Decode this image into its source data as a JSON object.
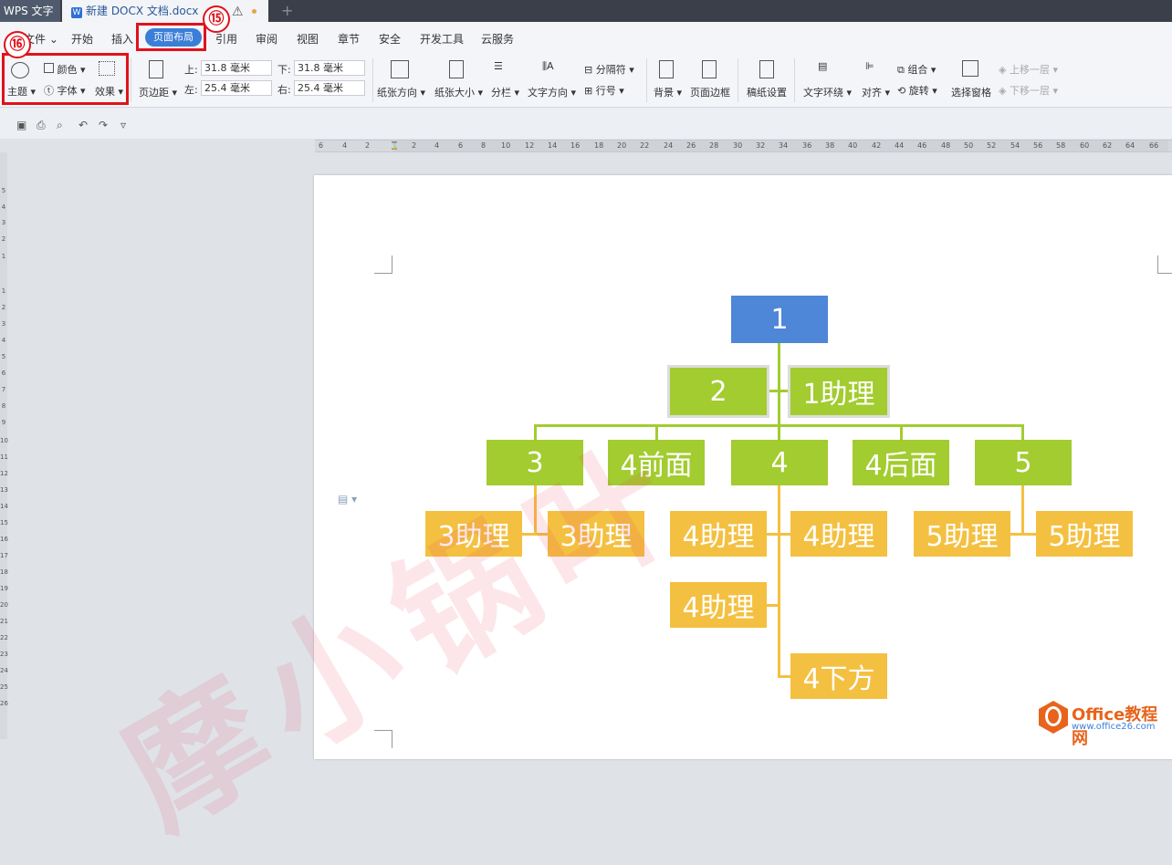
{
  "app": {
    "tab_app": "WPS 文字",
    "tab_doc": "新建 DOCX 文档.docx",
    "warning": "⚠",
    "add_tab": "+"
  },
  "menu": {
    "file": "文件",
    "items": [
      "开始",
      "插入",
      "页面布局",
      "引用",
      "审阅",
      "视图",
      "章节",
      "安全",
      "开发工具",
      "云服务"
    ],
    "active": "页面布局"
  },
  "ribbon": {
    "theme": "主题",
    "color": "颜色",
    "font": "字体",
    "effect": "效果",
    "margins": "页边距",
    "top_label": "上:",
    "top_value": "31.8 毫米",
    "bottom_label": "下:",
    "bottom_value": "31.8 毫米",
    "left_label": "左:",
    "left_value": "25.4 毫米",
    "right_label": "右:",
    "right_value": "25.4 毫米",
    "orientation": "纸张方向",
    "size": "纸张大小",
    "columns": "分栏",
    "text_dir": "文字方向",
    "separator": "分隔符",
    "line_num": "行号",
    "background": "背景",
    "border": "页面边框",
    "paper": "稿纸设置",
    "wrap": "文字环绕",
    "align": "对齐",
    "group": "组合",
    "rotate": "旋转",
    "select_pane": "选择窗格",
    "up": "上移一层",
    "down": "下移一层"
  },
  "ruler": {
    "ticks": [
      "6",
      "4",
      "2",
      "2",
      "4",
      "6",
      "8",
      "10",
      "12",
      "14",
      "16",
      "18",
      "20",
      "22",
      "24",
      "26",
      "28",
      "30",
      "32",
      "34",
      "36",
      "38",
      "40",
      "42",
      "44",
      "46",
      "48",
      "50",
      "52",
      "54",
      "56",
      "58",
      "60",
      "62",
      "64",
      "66"
    ]
  },
  "vruler": {
    "ticks": [
      "5",
      "4",
      "3",
      "2",
      "1",
      "1",
      "2",
      "3",
      "4",
      "5",
      "6",
      "7",
      "8",
      "9",
      "10",
      "11",
      "12",
      "13",
      "14",
      "15",
      "16",
      "17",
      "18",
      "19",
      "20",
      "21",
      "22",
      "23",
      "24",
      "25",
      "26"
    ]
  },
  "chart": {
    "root": "1",
    "level2": "2",
    "assistant": "1助理",
    "l3_0": "3",
    "l3_1": "4前面",
    "l3_2": "4",
    "l3_3": "4后面",
    "l3_4": "5",
    "a3a": "3助理",
    "a3b": "3助理",
    "a4a": "4助理",
    "a4b": "4助理",
    "a4c": "4助理",
    "a5a": "5助理",
    "a5b": "5助理",
    "below": "4下方"
  },
  "annotations": {
    "n15": "⑮",
    "n16": "⑯"
  },
  "watermark": "摩小锅叶",
  "logo": {
    "title": "Office教程网",
    "url": "www.office26.com"
  },
  "colors": {
    "top_box": "#4e86d8",
    "green_box": "#a2cc2f",
    "yellow_box": "#f4c041",
    "annotation": "#e0121b"
  }
}
